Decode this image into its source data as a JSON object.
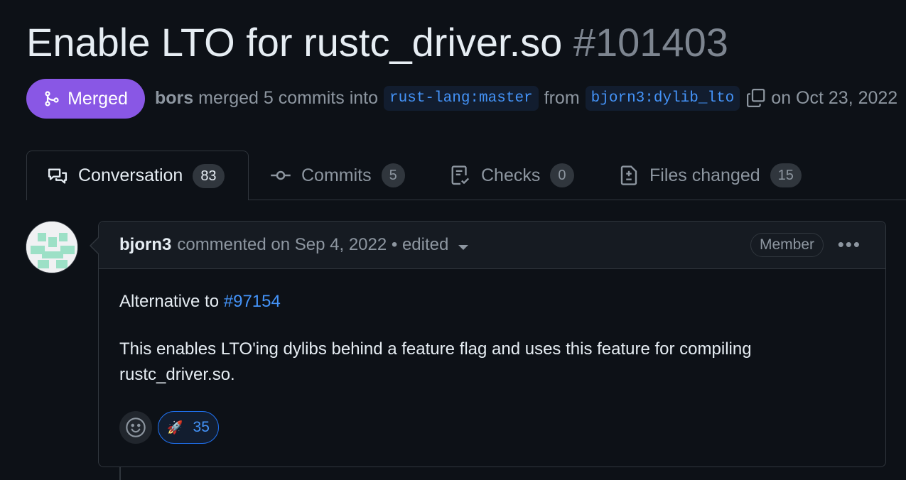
{
  "pr": {
    "title": "Enable LTO for rustc_driver.so",
    "number": "#101403",
    "state_label": "Merged",
    "merged_by": "bors",
    "merge_text": "merged 5 commits into",
    "base_branch": "rust-lang:master",
    "from_text": "from",
    "head_branch": "bjorn3:dylib_lto",
    "date_text": "on Oct 23, 2022"
  },
  "tabs": [
    {
      "label": "Conversation",
      "count": "83",
      "icon": "comment-discussion-icon"
    },
    {
      "label": "Commits",
      "count": "5",
      "icon": "git-commit-icon"
    },
    {
      "label": "Checks",
      "count": "0",
      "icon": "checklist-icon"
    },
    {
      "label": "Files changed",
      "count": "15",
      "icon": "file-diff-icon"
    }
  ],
  "comment": {
    "author": "bjorn3",
    "meta": "commented on Sep 4, 2022 • edited",
    "role_badge": "Member",
    "body_prefix": "Alternative to ",
    "body_link": "#97154",
    "body_para2": "This enables LTO'ing dylibs behind a feature flag and uses this feature for compiling rustc_driver.so.",
    "reaction_emoji": "🚀",
    "reaction_count": "35"
  },
  "colors": {
    "background": "#0d1117",
    "merged": "#8957e5",
    "link": "#4493f8",
    "border": "#30363d"
  }
}
